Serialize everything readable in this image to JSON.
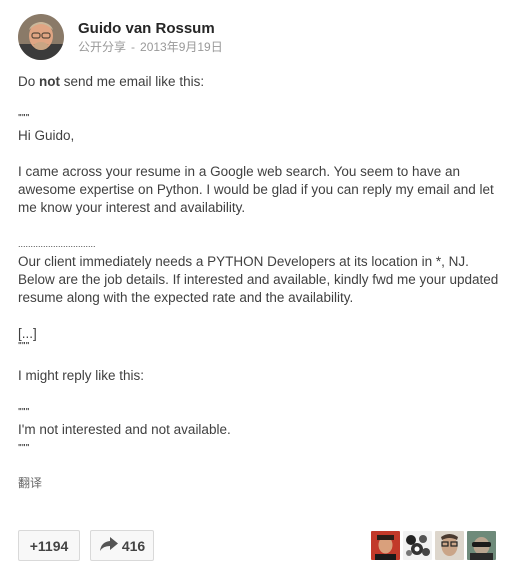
{
  "post": {
    "author": "Guido van Rossum",
    "visibility": "公开分享",
    "date": "2013年9月19日",
    "body": {
      "p1_pre": "Do ",
      "p1_bold": "not",
      "p1_post": " send me email like this:",
      "quote_open": "\"\"\"",
      "greeting": "Hi Guido,",
      "p2": "I came across your resume in a Google web search. You seem to have an awesome expertise on Python. I would be glad if you can reply my email and let me know your interest and availability.",
      "dots": "...............................",
      "p3": "Our client immediately needs a PYTHON Developers at its location in *, NJ. Below are the job details. If interested and available, kindly fwd me your updated resume along with the expected rate and the availability.",
      "ellipsis": "[...]",
      "quote_close": "\"\"\"",
      "p4": "I might reply like this:",
      "quote_open_2": "\"\"\"",
      "p5": "I'm not interested and not available.",
      "quote_close_2": "\"\"\""
    },
    "translate_label": "翻译"
  },
  "footer": {
    "plus_label": "+1194",
    "share_count": "416"
  },
  "icons": {
    "avatar": "author-avatar",
    "share": "share-arrow-icon"
  },
  "colors": {
    "text": "#404040",
    "meta": "#999999",
    "button_border": "#d9d9d9"
  }
}
